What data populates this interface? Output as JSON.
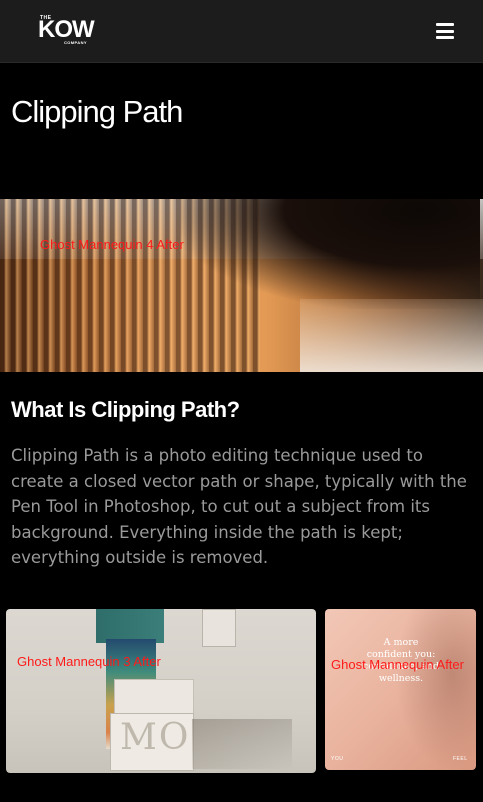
{
  "header": {
    "logo": {
      "top_text": "THE",
      "main_text": "KOW",
      "bottom_text": "COMPANY"
    },
    "menu_icon": "hamburger-menu-icon"
  },
  "page": {
    "title": "Clipping Path"
  },
  "hero_image": {
    "alt_text": "Ghost Mannequin 4 After"
  },
  "section": {
    "heading": "What Is Clipping Path?",
    "body": "Clipping Path is a photo editing technique used to create a closed vector path or shape, typically with the Pen Tool in Photoshop, to cut out a subject from its background. Everything inside the path is kept; everything outside is removed."
  },
  "gallery": [
    {
      "alt_text": "Ghost Mannequin 3 After",
      "box_label": "MO"
    },
    {
      "alt_text": "Ghost Mannequin After",
      "promo_text": "A more confident you: confidence, and wellness.",
      "footer_left": "YOU",
      "footer_right": "FEEL"
    }
  ],
  "colors": {
    "background": "#000000",
    "header": "#1c1c1c",
    "body_text": "#9a9a9a",
    "alt_text": "#ff1a1a"
  }
}
